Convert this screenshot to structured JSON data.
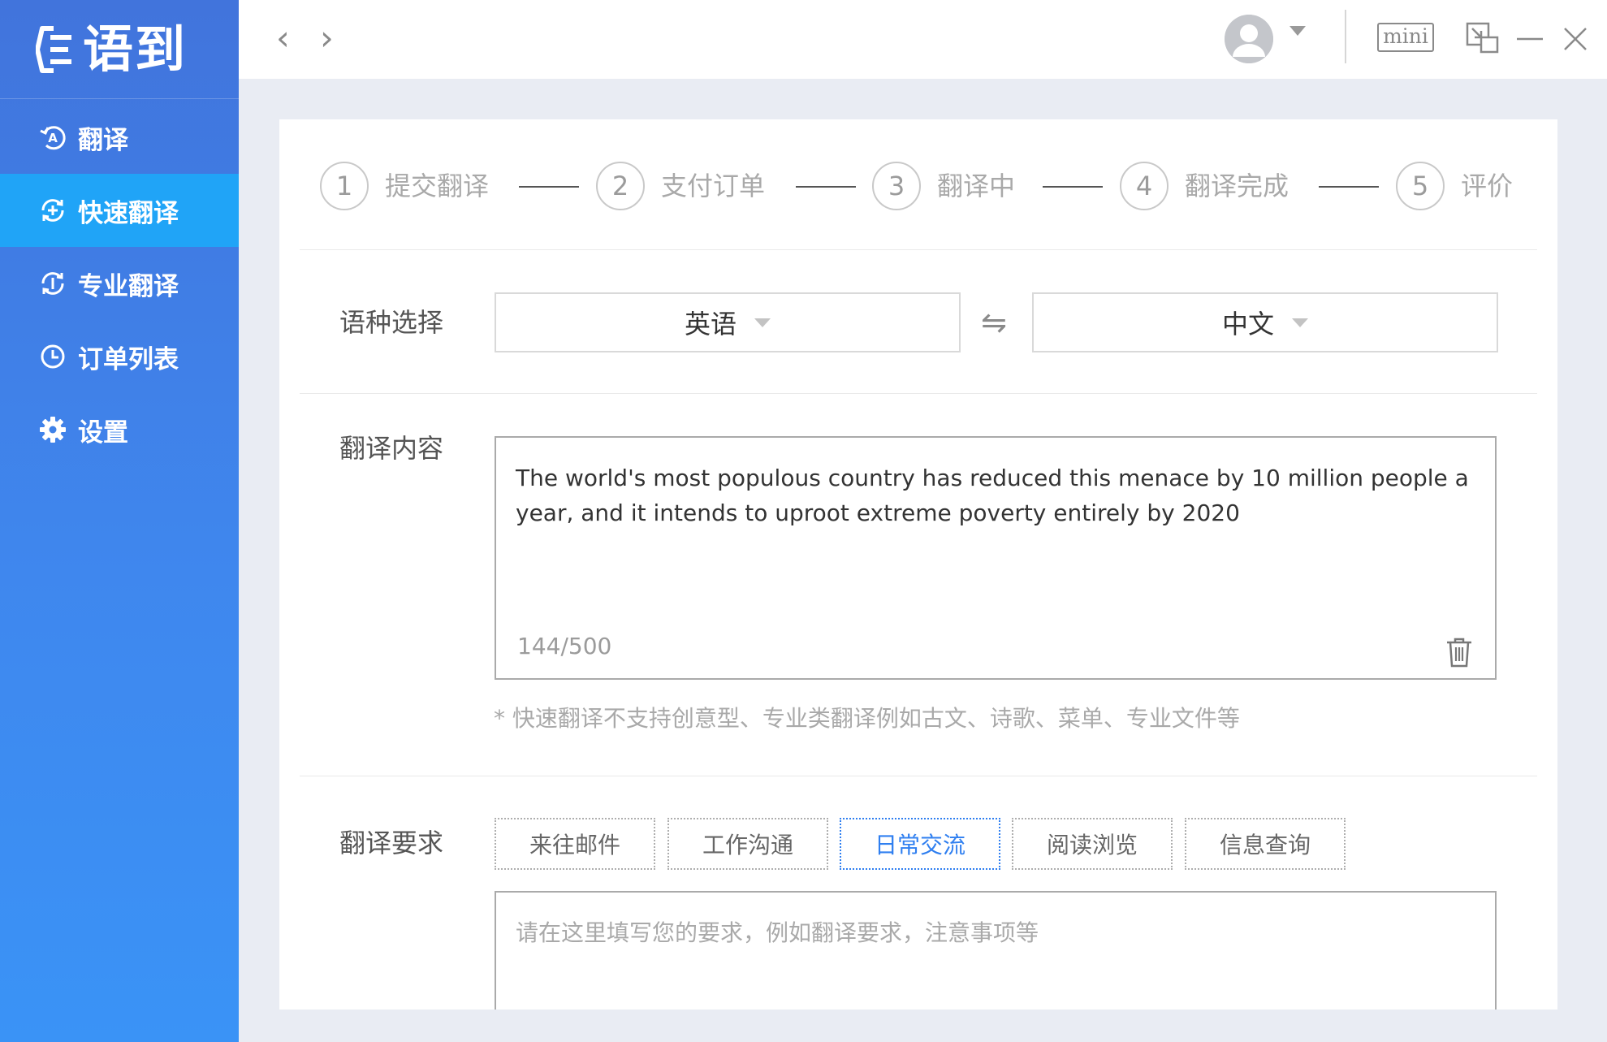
{
  "app": {
    "logo_text": "语到"
  },
  "sidebar": {
    "items": [
      {
        "label": "翻译",
        "icon": "translate-a-icon",
        "active": false
      },
      {
        "label": "快速翻译",
        "icon": "fast-translate-icon",
        "active": true
      },
      {
        "label": "专业翻译",
        "icon": "pro-translate-icon",
        "active": false
      },
      {
        "label": "订单列表",
        "icon": "clock-icon",
        "active": false
      },
      {
        "label": "设置",
        "icon": "gear-icon",
        "active": false
      }
    ]
  },
  "topbar": {
    "back_icon": "‹",
    "forward_icon": "›",
    "mini_label": "mini"
  },
  "steps": [
    {
      "num": "1",
      "label": "提交翻译"
    },
    {
      "num": "2",
      "label": "支付订单"
    },
    {
      "num": "3",
      "label": "翻译中"
    },
    {
      "num": "4",
      "label": "翻译完成"
    },
    {
      "num": "5",
      "label": "评价"
    }
  ],
  "language": {
    "label": "语种选择",
    "source": "英语",
    "target": "中文",
    "swap_symbol": "⇋"
  },
  "content": {
    "label": "翻译内容",
    "text": "The world's most populous country has reduced this menace by 10 million people a year, and it intends to uproot extreme poverty entirely by 2020",
    "char_count": "144/500",
    "hint": "* 快速翻译不支持创意型、专业类翻译例如古文、诗歌、菜单、专业文件等"
  },
  "requirements": {
    "label": "翻译要求",
    "tags": [
      "来往邮件",
      "工作沟通",
      "日常交流",
      "阅读浏览",
      "信息查询"
    ],
    "selected_tag": "日常交流",
    "placeholder": "请在这里填写您的要求，例如翻译要求，注意事项等"
  },
  "colors": {
    "sidebar_top": "#4174dc",
    "sidebar_bottom": "#3a93f6",
    "active_nav": "#20a4f7",
    "accent": "#2f7ff0",
    "page_bg": "#e9ecf3"
  }
}
